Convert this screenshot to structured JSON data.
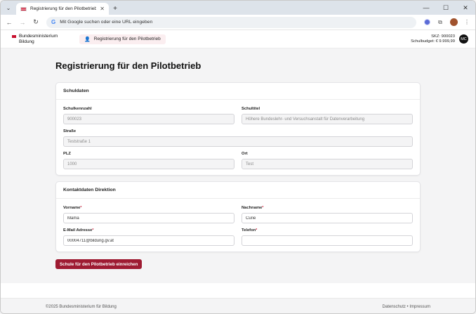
{
  "browser": {
    "tab_title": "Registrierung für den Pilotbetrieb",
    "omnibox_placeholder": "Mit Google suchen oder eine URL eingeben"
  },
  "header": {
    "logo_line1": "Bundesministerium",
    "logo_line2": "Bildung",
    "nav_tab_label": "Registrierung für den Pilotbetrieb",
    "school_id_line": "SKZ: 900023",
    "school_budget_line": "Schulbudget: € 9.999,99",
    "avatar_initials": "MC"
  },
  "page": {
    "title": "Registrierung für den Pilotbetrieb"
  },
  "schuldaten": {
    "heading": "Schuldaten",
    "schulkennzahl_label": "Schulkennzahl",
    "schulkennzahl_value": "900023",
    "schultitel_label": "Schultitel",
    "schultitel_value": "Höhere Bundeslehr- und Versuchsanstalt für Datenverarbeitung",
    "strasse_label": "Straße",
    "strasse_value": "Teststraße 1",
    "plz_label": "PLZ",
    "plz_value": "1000",
    "ort_label": "Ort",
    "ort_value": "Test"
  },
  "kontakt": {
    "heading": "Kontaktdaten Direktion",
    "vorname_label": "Vorname",
    "vorname_value": "Mama",
    "nachname_label": "Nachname",
    "nachname_value": "Curie",
    "email_label": "E-Mail Adresse",
    "email_value": "00004711@bildung.gv.at",
    "telefon_label": "Telefon",
    "telefon_value": "",
    "required_marker": "*"
  },
  "submit_label": "Schule für den Pilotbetrieb einreichen",
  "footer": {
    "copyright": "©2025 Bundesministerium für Bildung",
    "links": "Datenschutz • Impressum"
  },
  "colors": {
    "brand": "#9e1b32",
    "flag_red": "#c8102e"
  }
}
